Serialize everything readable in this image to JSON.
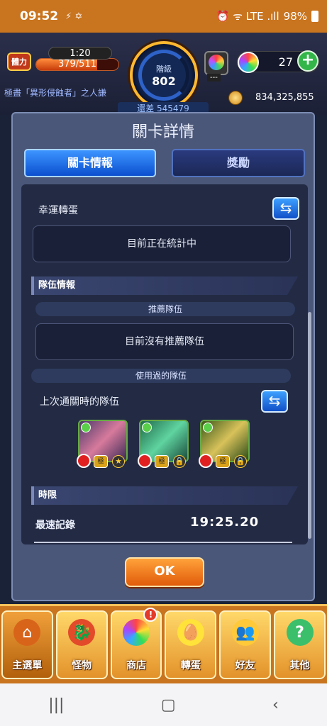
{
  "status_bar": {
    "time": "09:52",
    "icons": "⚡ ✡",
    "right_icons": "⏰ ᯤ LTE .ıll",
    "battery": "98%"
  },
  "header": {
    "stamina_label": "體力",
    "stamina_timer": "1:20",
    "stamina_value": "379/511",
    "stamina_fraction": 0.742,
    "rank_label": "階級",
    "rank_value": "802",
    "rank_diff": "還差 545479",
    "gem_slot_value": "---",
    "orbs": "27",
    "orb_plus": "+",
    "player_title": "極盡「異形侵蝕者」之人謙",
    "coins": "834,325,855"
  },
  "dialog": {
    "title": "關卡詳情",
    "tabs": [
      {
        "label": "關卡情報",
        "active": true
      },
      {
        "label": "獎勵",
        "active": false
      }
    ],
    "lucky_egg_label": "幸運轉蛋",
    "lucky_egg_status": "目前正在統計中",
    "team_section": "隊伍情報",
    "recommended_label": "推薦隊伍",
    "recommended_status": "目前沒有推薦隊伍",
    "used_teams_label": "使用過的隊伍",
    "last_clear_label": "上次通關時的隊伍",
    "monsters": [
      {
        "tag": "極",
        "extra": "★"
      },
      {
        "tag": "極",
        "extra": "🔒"
      },
      {
        "tag": "極",
        "extra": "🔒"
      }
    ],
    "time_section": "時限",
    "best_record_label": "最速記錄",
    "best_record_value": "19:25.20",
    "ok_label": "OK",
    "swap_icon": "⇆"
  },
  "bottom_nav": [
    {
      "label": "主選單",
      "icon": "⌂"
    },
    {
      "label": "怪物",
      "icon": "🐉"
    },
    {
      "label": "商店",
      "icon": "●",
      "alert": "!"
    },
    {
      "label": "轉蛋",
      "icon": "🥚"
    },
    {
      "label": "好友",
      "icon": "👥"
    },
    {
      "label": "其他",
      "icon": "?"
    }
  ],
  "system_nav": {
    "recents": "|||",
    "home": "▢",
    "back": "‹"
  },
  "colors": {
    "accent_blue": "#0b4fcf",
    "accent_orange": "#e15b0a",
    "nav_bg": "#c9741e"
  }
}
